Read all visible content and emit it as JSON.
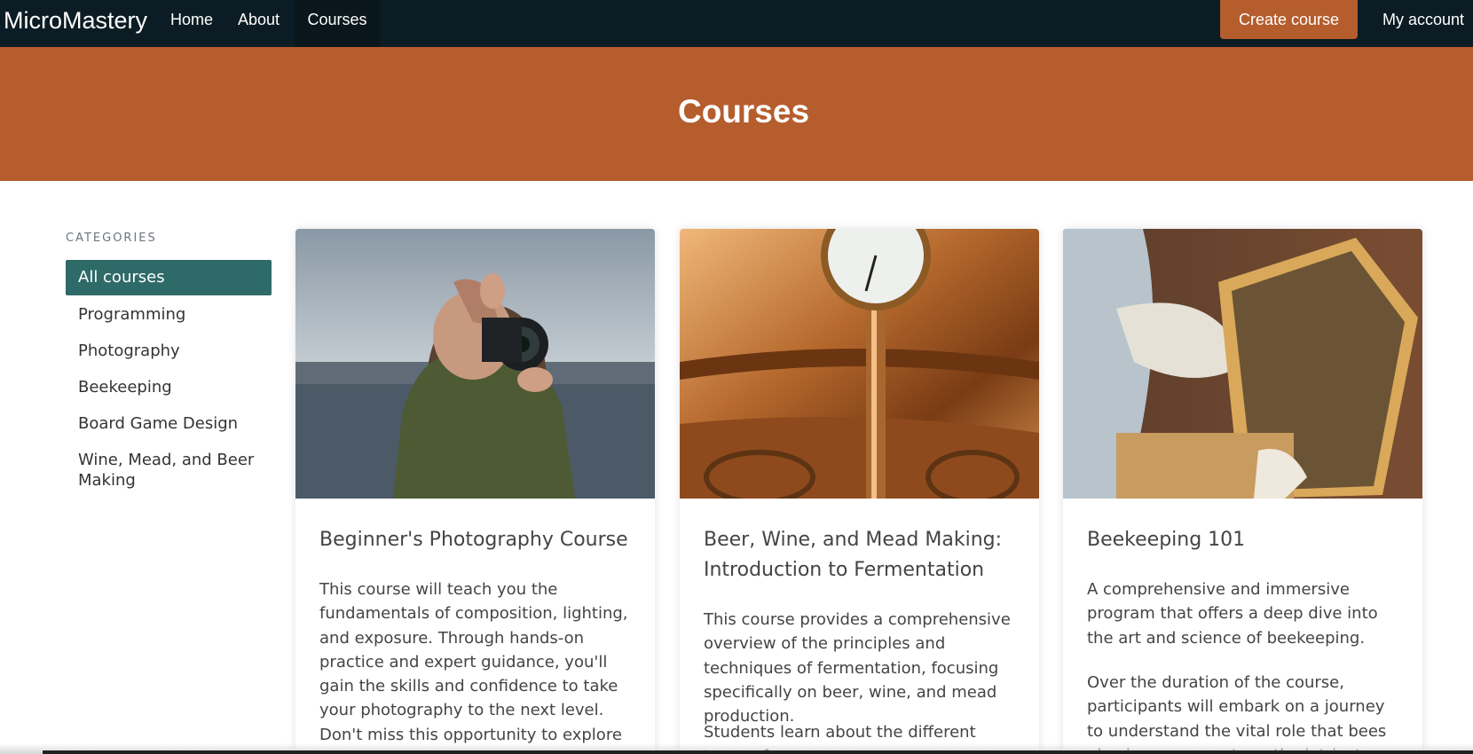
{
  "navbar": {
    "brand": "MicroMastery",
    "links": [
      "Home",
      "About",
      "Courses"
    ],
    "active_link": "Courses",
    "create_button": "Create course",
    "account": "My account"
  },
  "hero": {
    "title": "Courses"
  },
  "sidebar": {
    "heading": "CATEGORIES",
    "items": [
      {
        "label": "All courses",
        "active": true
      },
      {
        "label": "Programming"
      },
      {
        "label": "Photography"
      },
      {
        "label": "Beekeeping"
      },
      {
        "label": "Board Game Design"
      },
      {
        "label": "Wine, Mead, and Beer Making"
      }
    ]
  },
  "courses": [
    {
      "title": "Beginner's Photography Course",
      "paragraphs": [
        "This course will teach you the fundamentals of composition, lighting, and exposure. Through hands-on practice and expert guidance, you'll gain the skills and confidence to take your photography to the next level. Don't miss this opportunity to explore the art of"
      ]
    },
    {
      "title": "Beer, Wine, and Mead Making: Introduction to Fermentation",
      "paragraphs": [
        "This course provides a comprehensive overview of the principles and techniques of fermentation, focusing specifically on beer, wine, and mead production.",
        "Students learn about the different types of"
      ]
    },
    {
      "title": "Beekeeping 101",
      "paragraphs": [
        "A comprehensive and immersive program that offers a deep dive into the art and science of beekeeping.",
        "Over the duration of the course, participants will embark on a journey to understand the vital role that bees play in our ecosystem, the intricate dynamics of a"
      ]
    }
  ],
  "colors": {
    "navbar": "#0c1c24",
    "accent": "#b55d2d",
    "active_category": "#2e6a68"
  }
}
